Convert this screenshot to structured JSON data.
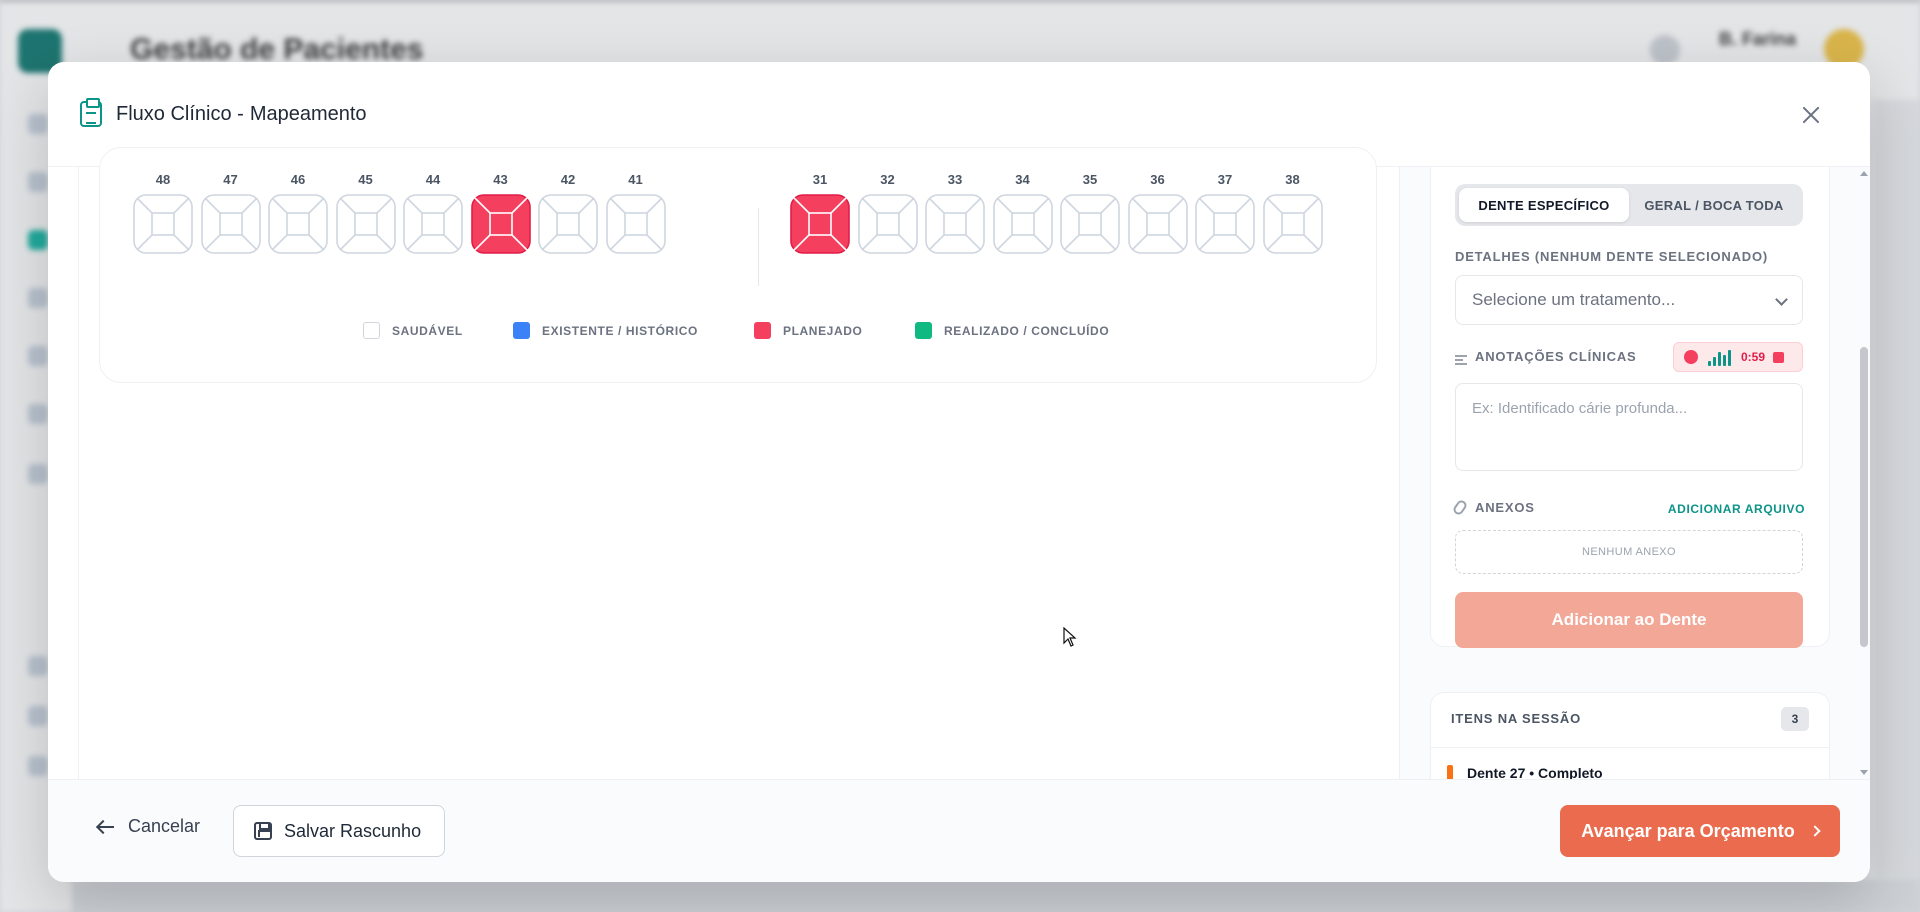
{
  "background": {
    "app_title": "Gestão de Pacientes",
    "user_name": "B. Farina"
  },
  "modal": {
    "title": "Fluxo Clínico -",
    "subtitle": "Mapeamento"
  },
  "odontogram": {
    "left_teeth": [
      {
        "number": "48",
        "status": "healthy"
      },
      {
        "number": "47",
        "status": "healthy"
      },
      {
        "number": "46",
        "status": "healthy"
      },
      {
        "number": "45",
        "status": "healthy"
      },
      {
        "number": "44",
        "status": "healthy"
      },
      {
        "number": "43",
        "status": "planned"
      },
      {
        "number": "42",
        "status": "healthy"
      },
      {
        "number": "41",
        "status": "healthy"
      }
    ],
    "right_teeth": [
      {
        "number": "31",
        "status": "planned"
      },
      {
        "number": "32",
        "status": "healthy"
      },
      {
        "number": "33",
        "status": "healthy"
      },
      {
        "number": "34",
        "status": "healthy"
      },
      {
        "number": "35",
        "status": "healthy"
      },
      {
        "number": "36",
        "status": "healthy"
      },
      {
        "number": "37",
        "status": "healthy"
      },
      {
        "number": "38",
        "status": "healthy"
      }
    ],
    "legend": [
      {
        "label": "SAUDÁVEL",
        "color": "#ffffff"
      },
      {
        "label": "EXISTENTE / HISTÓRICO",
        "color": "#3b82f6"
      },
      {
        "label": "PLANEJADO",
        "color": "#f43f5e"
      },
      {
        "label": "REALIZADO / CONCLUÍDO",
        "color": "#10b981"
      }
    ]
  },
  "panel": {
    "tab_specific": "DENTE ESPECÍFICO",
    "tab_general": "GERAL / BOCA TODA",
    "details_label": "DETALHES (NENHUM DENTE SELECIONADO)",
    "treatment_placeholder": "Selecione um tratamento...",
    "notes_label": "ANOTAÇÕES CLÍNICAS",
    "recording_time": "0:59",
    "notes_placeholder": "Ex: Identificado cárie profunda...",
    "attachments_label": "ANEXOS",
    "add_file": "ADICIONAR ARQUIVO",
    "no_attachments": "NENHUM ANEXO",
    "add_button": "Adicionar ao Dente"
  },
  "session": {
    "title": "ITENS NA SESSÃO",
    "count": "3",
    "first_item": "Dente 27 • Completo"
  },
  "footer": {
    "cancel": "Cancelar",
    "save_draft": "Salvar Rascunho",
    "next": "Avançar para Orçamento"
  },
  "colors": {
    "accent": "#ea6b4e",
    "teal": "#0d9488",
    "planned": "#f43f5e"
  }
}
